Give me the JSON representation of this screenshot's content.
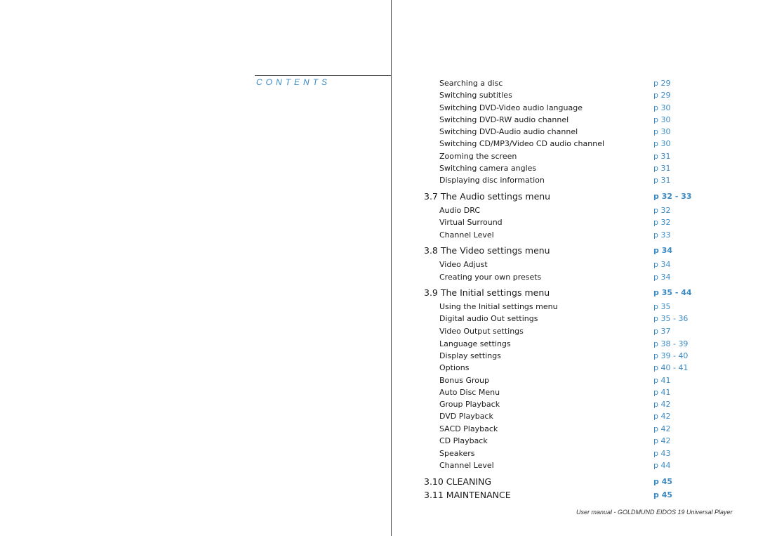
{
  "contents_title": "CONTENTS",
  "entries": [
    {
      "type": "item",
      "label": "Searching a disc",
      "page": "p 29"
    },
    {
      "type": "item",
      "label": "Switching subtitles",
      "page": "p 29"
    },
    {
      "type": "item",
      "label": "Switching DVD-Video audio language",
      "page": "p 30"
    },
    {
      "type": "item",
      "label": "Switching DVD-RW audio channel",
      "page": "p 30"
    },
    {
      "type": "item",
      "label": "Switching DVD-Audio audio channel",
      "page": "p 30"
    },
    {
      "type": "item",
      "label": "Switching CD/MP3/Video CD audio channel",
      "page": "p 30"
    },
    {
      "type": "item",
      "label": "Zooming the screen",
      "page": "p 31"
    },
    {
      "type": "item",
      "label": "Switching camera angles",
      "page": "p 31"
    },
    {
      "type": "item",
      "label": "Displaying disc information",
      "page": "p 31"
    },
    {
      "type": "section",
      "label": "3.7 The Audio settings menu",
      "page": "p 32 - 33"
    },
    {
      "type": "item",
      "label": "Audio DRC",
      "page": "p 32"
    },
    {
      "type": "item",
      "label": "Virtual Surround",
      "page": "p 32"
    },
    {
      "type": "item",
      "label": "Channel Level",
      "page": "p 33"
    },
    {
      "type": "section",
      "label": "3.8 The Video settings menu",
      "page": "p 34"
    },
    {
      "type": "item",
      "label": "Video Adjust",
      "page": "p 34"
    },
    {
      "type": "item",
      "label": "Creating your own presets",
      "page": "p 34"
    },
    {
      "type": "section",
      "label": "3.9 The Initial settings menu",
      "page": "p 35 - 44"
    },
    {
      "type": "item",
      "label": "Using the Initial settings menu",
      "page": "p 35"
    },
    {
      "type": "item",
      "label": "Digital audio Out settings",
      "page": "p 35 - 36"
    },
    {
      "type": "item",
      "label": "Video Output settings",
      "page": "p 37"
    },
    {
      "type": "item",
      "label": "Language settings",
      "page": "p 38 - 39"
    },
    {
      "type": "item",
      "label": "Display settings",
      "page": "p 39 - 40"
    },
    {
      "type": "item",
      "label": "Options",
      "page": "p 40 - 41"
    },
    {
      "type": "item",
      "label": "Bonus Group",
      "page": "p 41"
    },
    {
      "type": "item",
      "label": "Auto Disc Menu",
      "page": "p 41"
    },
    {
      "type": "item",
      "label": "Group Playback",
      "page": "p 42"
    },
    {
      "type": "item",
      "label": "DVD Playback",
      "page": "p 42"
    },
    {
      "type": "item",
      "label": "SACD Playback",
      "page": "p 42"
    },
    {
      "type": "item",
      "label": "CD Playback",
      "page": "p 42"
    },
    {
      "type": "item",
      "label": "Speakers",
      "page": "p 43"
    },
    {
      "type": "item",
      "label": "Channel Level",
      "page": "p 44"
    },
    {
      "type": "section",
      "label": "3.10 CLEANING",
      "page": "p 45"
    },
    {
      "type": "section",
      "label": "3.11 MAINTENANCE",
      "page": "p 45"
    }
  ],
  "footer": "User manual - GOLDMUND EIDOS 19 Universal Player",
  "colors": {
    "accent": "#3a8ac4",
    "text": "#1a1a1a",
    "rule": "#555555"
  }
}
